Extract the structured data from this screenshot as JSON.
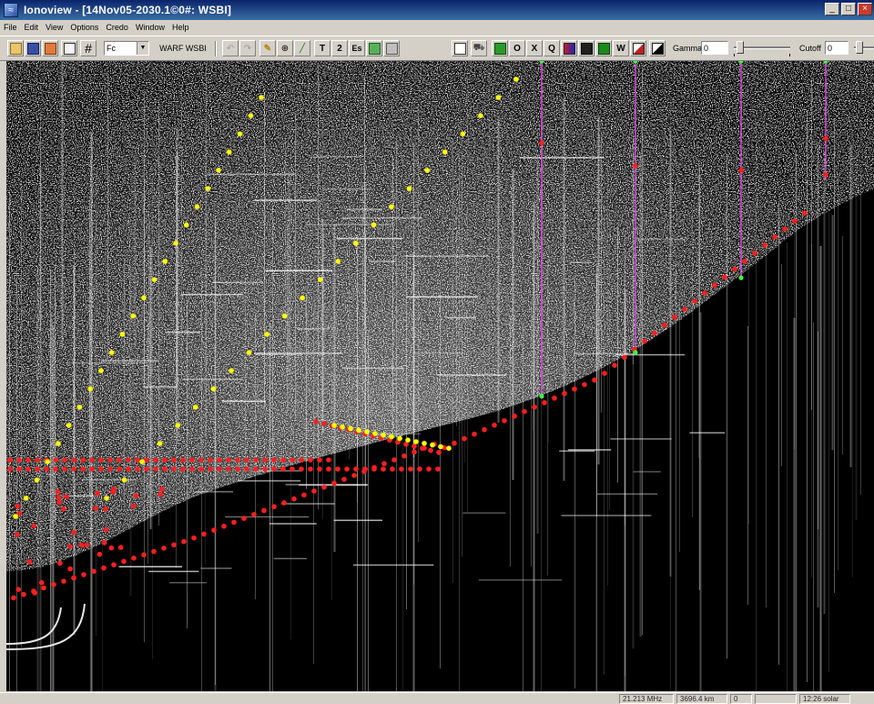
{
  "window": {
    "title": "Ionoview - [14Nov05-2030.1©0#: WSBI]",
    "controls": [
      "_",
      "□",
      "×"
    ]
  },
  "menu": [
    {
      "id": "file",
      "label": "File"
    },
    {
      "id": "edit",
      "label": "Edit"
    },
    {
      "id": "view",
      "label": "View"
    },
    {
      "id": "options",
      "label": "Options"
    },
    {
      "id": "credo",
      "label": "Credo"
    },
    {
      "id": "window",
      "label": "Window"
    },
    {
      "id": "help",
      "label": "Help"
    }
  ],
  "toolbar": {
    "mode_select": "Fc",
    "station_label": "WARF WSBI",
    "trace_buttons": [
      "T",
      "2",
      "Es"
    ],
    "display_buttons": [
      "O",
      "X",
      "Q",
      "W"
    ],
    "gamma_label": "Gamma",
    "gamma_value": "0",
    "cutoff_label": "Cutoff",
    "cutoff_value": "0"
  },
  "statusbar": {
    "frequency": "21.213 MHz",
    "range": "3696.4 km",
    "value": "0",
    "blank": "",
    "time": "12:26 solar"
  },
  "colors": {
    "plot_background": "#000000",
    "echo_white": "#ffffff",
    "marker_red": "#ff1f1f",
    "marker_yellow": "#ffff00",
    "marker_green": "#3cff3c",
    "trace_magenta": "#d84cd8"
  }
}
